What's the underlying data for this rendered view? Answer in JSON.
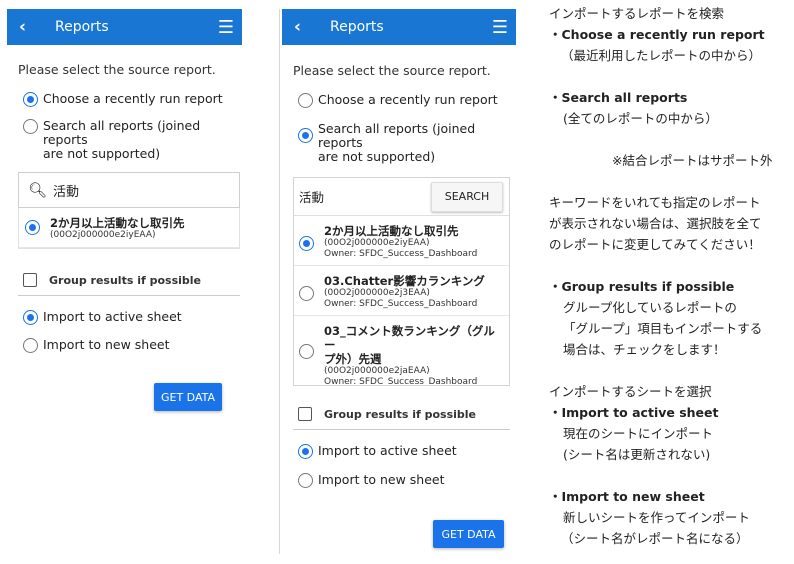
{
  "app": {
    "title": "Reports"
  },
  "panel1": {
    "prompt": "Please select the source report.",
    "option_recent": "Choose a recently run report",
    "option_search_line1": "Search all reports (joined reports",
    "option_search_line2": "are not supported)",
    "search_value": "活動",
    "result": {
      "name": "2か月以上活動なし取引先",
      "id": "(00O2j000000e2iyEAA)"
    },
    "group_label": "Group results if possible",
    "import_active": "Import to active sheet",
    "import_new": "Import to new sheet",
    "get_data": "GET DATA"
  },
  "panel2": {
    "prompt": "Please select the source report.",
    "option_recent": "Choose a recently run report",
    "option_search_line1": "Search all reports (joined reports",
    "option_search_line2": "are not supported)",
    "search_value": "活動",
    "search_button": "SEARCH",
    "results": [
      {
        "name": "2か月以上活動なし取引先",
        "id": "(00O2j000000e2iyEAA)",
        "owner": "Owner: SFDC_Success_Dashboard"
      },
      {
        "name": "03.Chatter影響カランキング",
        "id": "(00O2j000000e2j3EAA)",
        "owner": "Owner: SFDC_Success_Dashboard"
      },
      {
        "name_line1": "03_コメント数ランキング（グルー",
        "name_line2": "プ外）先週",
        "id": "(00O2j000000e2jaEAA)",
        "owner": "Owner: SFDC_Success_Dashboard"
      }
    ],
    "group_label": "Group results if possible",
    "import_active": "Import to active sheet",
    "import_new": "Import to new sheet",
    "get_data": "GET DATA"
  },
  "notes": {
    "l1": "インポートするレポートを検索",
    "l2": "・Choose a recently run report",
    "l3": "（最近利用したレポートの中から）",
    "l4": "・Search all reports",
    "l5": "(全てのレポートの中から）",
    "l6": "※結合レポートはサポート外",
    "l7": "キーワードをいれても指定のレポート",
    "l8": "が表示されない場合は、選択肢を全て",
    "l9": "のレポートに変更してみてください！",
    "l10": "・Group results if possible",
    "l11": "グループ化しているレポートの",
    "l12": "「グループ」項目もインポートする",
    "l13": "場合は、チェックをします！",
    "l14": "インポートするシートを選択",
    "l15": "・Import to active sheet",
    "l16": "現在のシートにインポート",
    "l17": "(シート名は更新されない)",
    "l18": "・Import to new sheet",
    "l19": "新しいシートを作ってインポート",
    "l20": "（シート名がレポート名になる）"
  }
}
